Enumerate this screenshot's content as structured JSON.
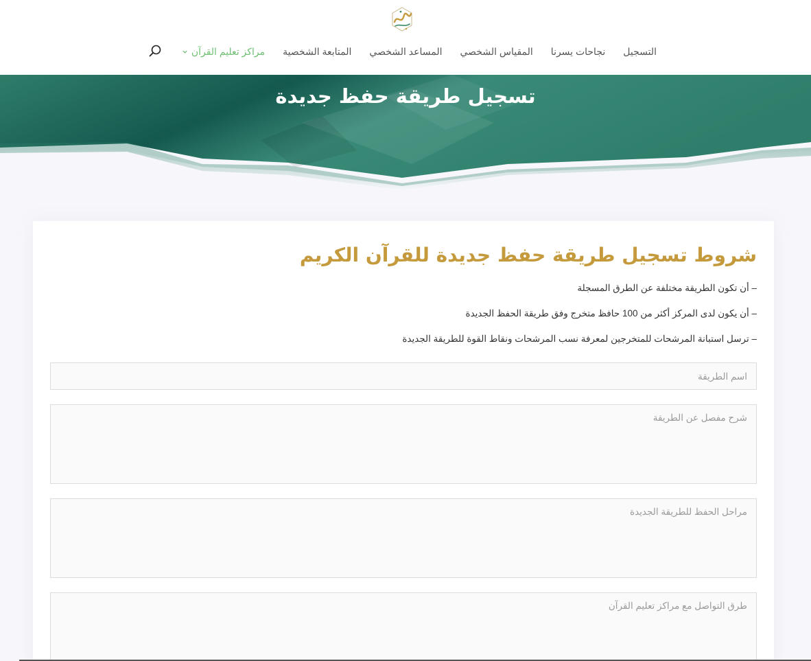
{
  "nav": {
    "items": [
      {
        "label": "التسجيل"
      },
      {
        "label": "نجاحات يسرنا"
      },
      {
        "label": "المقياس الشخصي"
      },
      {
        "label": "المساعد الشخصي"
      },
      {
        "label": "المتابعة الشخصية"
      },
      {
        "label": "مراكز تعليم القرآن"
      }
    ],
    "active_color": "#6fbf73"
  },
  "hero": {
    "title": "تسجيل طريقة حفظ جديدة",
    "color": "#1f6b5c"
  },
  "card": {
    "title": "شروط تسجيل طريقة حفظ جديدة للقرآن الكريم",
    "title_color": "#c49a3c",
    "conditions": [
      "– أن تكون الطريقة مختلفة عن الطرق المسجلة",
      "– أن يكون لدى المركز أكثر من 100 حافظ متخرج وفق طريقة الحفظ الجديدة",
      "– ترسل استبانة المرشحات للمتخرجين لمعرفة نسب المرشحات ونقاط القوة للطريقة الجديدة"
    ]
  },
  "form": {
    "method_name_placeholder": "اسم الطريقة",
    "description_placeholder": "شرح مفصل عن الطريقة",
    "stages_placeholder": "مراحل الحفظ للطريقة الجديدة",
    "contact_placeholder": "طرق التواصل مع مراكز تعليم القرآن"
  },
  "icons": {
    "search": "search-icon",
    "chevron": "chevron-down-icon",
    "logo": "yassirna-logo"
  }
}
